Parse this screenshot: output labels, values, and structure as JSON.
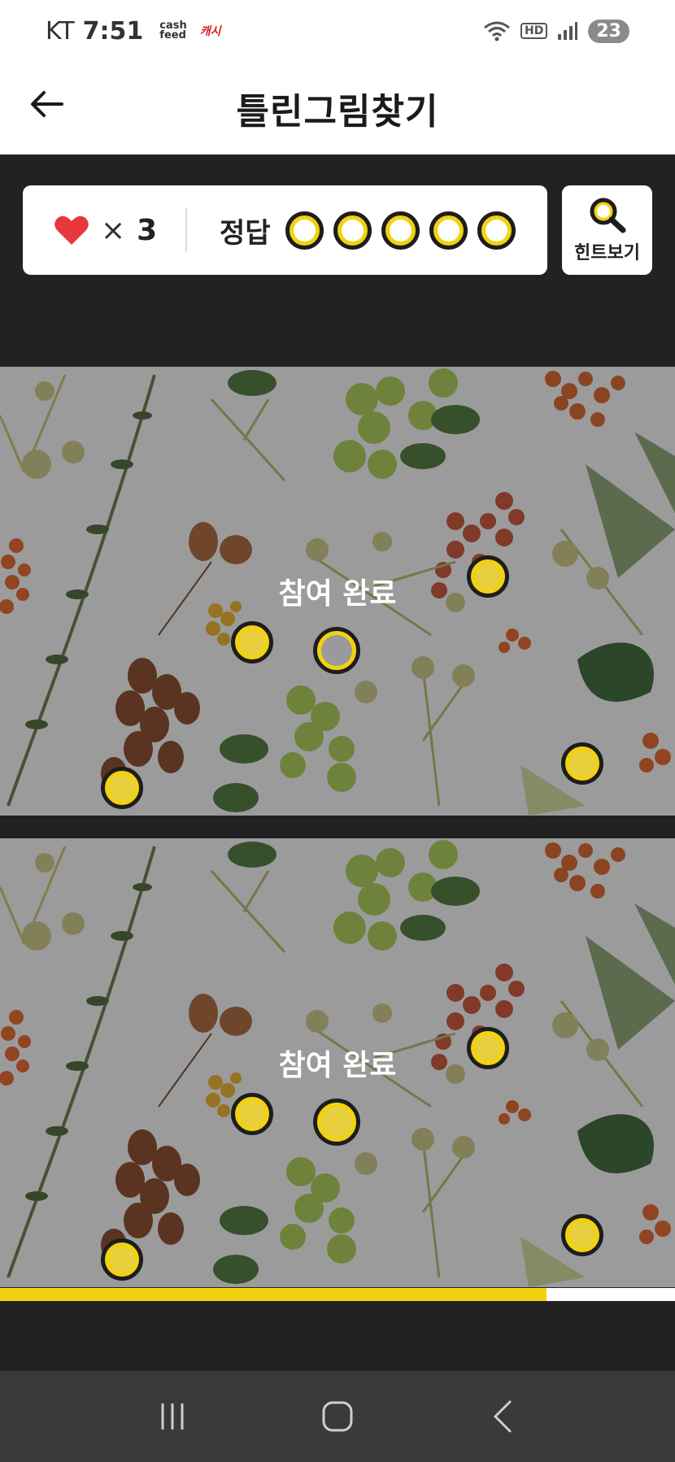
{
  "status": {
    "carrier": "KT",
    "time": "7:51",
    "mini_app1": "cash\nfeed",
    "mini_app2": "캐시",
    "hd": "HD",
    "battery": "23"
  },
  "header": {
    "title": "틀린그림찾기"
  },
  "score": {
    "lives_multiplier": "×",
    "lives": "3",
    "answer_label": "정답",
    "answer_slots": 5,
    "hint_label": "힌트보기"
  },
  "game": {
    "top_status": "참여 완료",
    "bottom_status": "참여 완료"
  },
  "progress": {
    "fraction": 0.81
  },
  "colors": {
    "accent": "#f2d210",
    "heart": "#e8373d",
    "dark": "#222222"
  }
}
